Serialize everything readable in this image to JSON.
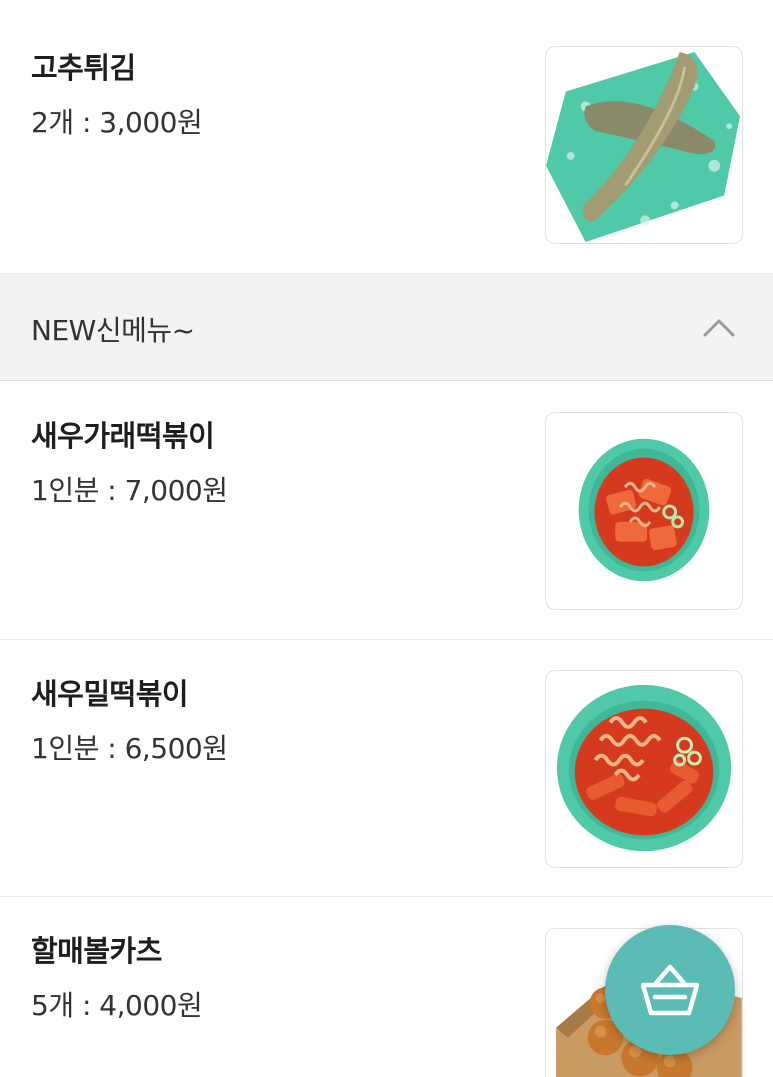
{
  "items_top": [
    {
      "name": "고추튀김",
      "price": "2개 : 3,000원",
      "image_icon": "fried-pepper-image"
    }
  ],
  "category": {
    "title": "NEW신메뉴~",
    "toggle_icon": "chevron-up-icon"
  },
  "items_new": [
    {
      "name": "새우가래떡볶이",
      "price": "1인분 : 7,000원",
      "image_icon": "shrimp-rice-cake-tteokbokki-image"
    },
    {
      "name": "새우밀떡볶이",
      "price": "1인분 : 6,500원",
      "image_icon": "shrimp-wheat-tteokbokki-image"
    },
    {
      "name": "할매볼카츠",
      "price": "5개 : 4,000원",
      "image_icon": "ball-katsu-image"
    }
  ],
  "cart": {
    "icon": "shopping-basket-icon",
    "color": "#5bbcb6"
  },
  "colors": {
    "bowl_green": "#4fc9a8",
    "sauce_red": "#d63a1e"
  }
}
